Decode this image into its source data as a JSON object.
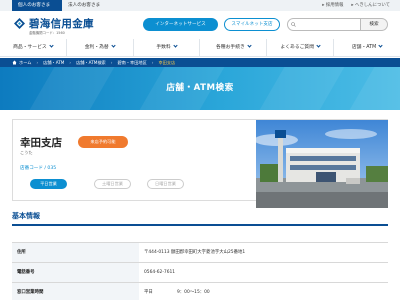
{
  "top_bar": {
    "personal_label": "個人のお客さま",
    "corporate_label": "法人のお客さま",
    "links": [
      "▸ 採用情報",
      "▸ へきしんについて"
    ]
  },
  "header": {
    "brand_name": "碧海信用金庫",
    "brand_sub": "金融機関コード：1560",
    "internet_service_label": "インターネットサービス",
    "smartphone_label": "スマイルネット支店",
    "search_placeholder": "",
    "search_button_label": "検索"
  },
  "nav": {
    "items": [
      "商品・サービス",
      "金利・為替",
      "手数料",
      "各種お手続き",
      "よくあるご質問",
      "店舗・ATM"
    ]
  },
  "breadcrumb": {
    "items": [
      "ホーム",
      "店舗・ATM",
      "店舗・ATM検索",
      "碧南・幸田地区",
      "幸田支店"
    ]
  },
  "hero": {
    "title": "店舗・ATM検索"
  },
  "branch": {
    "name": "幸田支店",
    "kana": "こうた",
    "reserve_badge": "来店予約可能",
    "store_code": "店番コード / 035",
    "day_tabs": [
      "平日営業",
      "土曜日営業",
      "日曜日営業"
    ],
    "active_tab_index": 0
  },
  "basic_info": {
    "title": "基本情報",
    "rows": [
      {
        "label": "住所",
        "value": "〒444-0113 額田郡幸田町大字菱池字大山25番地1"
      },
      {
        "label": "電話番号",
        "value": "0564-62-7611"
      },
      {
        "label": "窓口営業時間",
        "value": "平日",
        "value2": "9：00～15：00"
      }
    ]
  },
  "colors": {
    "brand_navy": "#0a4e93",
    "accent_blue": "#0c8fd1",
    "reserve_orange": "#f07a2e",
    "crumb_current": "#f6c94a"
  }
}
